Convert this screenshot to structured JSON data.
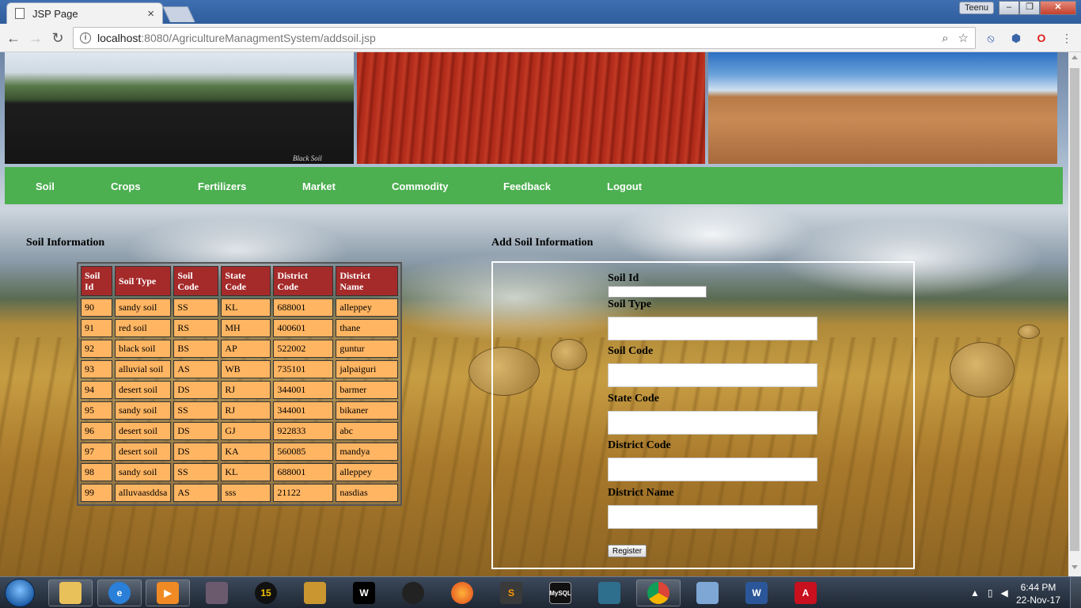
{
  "browser": {
    "tab_title": "JSP Page",
    "tab_close": "×",
    "user_badge": "Teenu",
    "url_host": "localhost",
    "url_rest": ":8080/AgricultureManagmentSystem/addsoil.jsp"
  },
  "banner": {
    "caption": "Black Soil"
  },
  "nav": {
    "items": [
      "Soil",
      "Crops",
      "Fertilizers",
      "Market",
      "Commodity",
      "Feedback",
      "Logout"
    ]
  },
  "soil_info": {
    "title": "Soil Information",
    "columns": [
      "Soil Id",
      "Soil Type",
      "Soil Code",
      "State Code",
      "District Code",
      "District Name"
    ],
    "rows": [
      [
        "90",
        "sandy soil",
        "SS",
        "KL",
        "688001",
        "alleppey"
      ],
      [
        "91",
        "red soil",
        "RS",
        "MH",
        "400601",
        "thane"
      ],
      [
        "92",
        "black soil",
        "BS",
        "AP",
        "522002",
        "guntur"
      ],
      [
        "93",
        "alluvial soil",
        "AS",
        "WB",
        "735101",
        "jalpaiguri"
      ],
      [
        "94",
        "desert soil",
        "DS",
        "RJ",
        "344001",
        "barmer"
      ],
      [
        "95",
        "sandy soil",
        "SS",
        "RJ",
        "344001",
        "bikaner"
      ],
      [
        "96",
        "desert soil",
        "DS",
        "GJ",
        "922833",
        "abc"
      ],
      [
        "97",
        "desert soil",
        "DS",
        "KA",
        "560085",
        "mandya"
      ],
      [
        "98",
        "sandy soil",
        "SS",
        "KL",
        "688001",
        "alleppey"
      ],
      [
        "99",
        "alluvaasddsa",
        "AS",
        "sss",
        "21122",
        "nasdias"
      ]
    ]
  },
  "add_form": {
    "title": "Add Soil Information",
    "soil_id_label": "Soil Id",
    "soil_type_label": "Soil Type",
    "soil_code_label": "Soil Code",
    "state_code_label": "State Code",
    "district_code_label": "District Code",
    "district_name_label": "District Name",
    "submit_label": "Register"
  },
  "taskbar": {
    "apps": [
      "explorer",
      "internet-explorer",
      "media-player",
      "game-1",
      "pes-15",
      "counter-strike",
      "wwe",
      "sleeping-dogs",
      "firefox",
      "sublime-text",
      "mysql-console",
      "mysql-workbench",
      "chrome",
      "virtualbox",
      "word",
      "acrobat"
    ],
    "app_15_label": "15",
    "app_mysql_label": "MySQL",
    "time": "6:44 PM",
    "date": "22-Nov-17"
  },
  "colors": {
    "nav_bg": "#4caf50",
    "table_header_bg": "#a52a2a",
    "table_cell_bg": "#ffb562"
  }
}
